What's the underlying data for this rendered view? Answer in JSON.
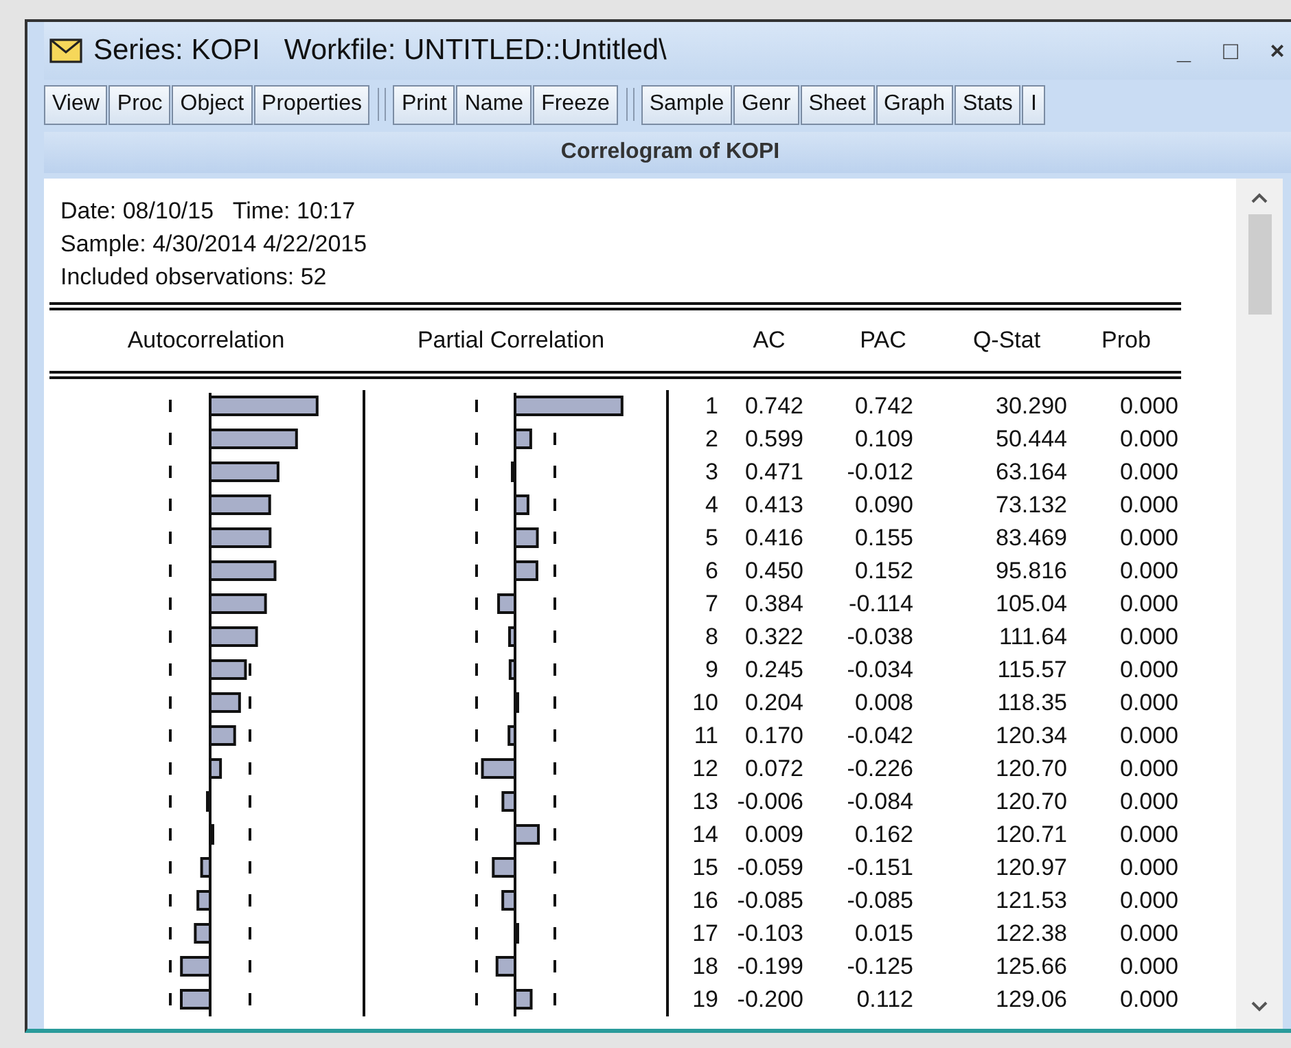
{
  "window": {
    "title": "Series: KOPI   Workfile: UNTITLED::Untitled\\",
    "controls": [
      "_",
      "□",
      "×"
    ]
  },
  "toolbar": [
    [
      "View",
      "Proc",
      "Object",
      "Properties"
    ],
    [
      "Print",
      "Name",
      "Freeze"
    ],
    [
      "Sample",
      "Genr",
      "Sheet",
      "Graph",
      "Stats",
      "I"
    ]
  ],
  "view_title": "Correlogram of KOPI",
  "info": [
    "Date: 08/10/15   Time: 10:17",
    "Sample: 4/30/2014 4/22/2015",
    "Included observations: 52"
  ],
  "columns": [
    "Autocorrelation",
    "Partial Correlation",
    "AC",
    "PAC",
    "Q-Stat",
    "Prob"
  ],
  "rows": [
    {
      "lag": "1",
      "ac": "0.742",
      "pac": "0.742",
      "q": "30.290",
      "prob": "0.000"
    },
    {
      "lag": "2",
      "ac": "0.599",
      "pac": "0.109",
      "q": "50.444",
      "prob": "0.000"
    },
    {
      "lag": "3",
      "ac": "0.471",
      "pac": "-0.012",
      "q": "63.164",
      "prob": "0.000"
    },
    {
      "lag": "4",
      "ac": "0.413",
      "pac": "0.090",
      "q": "73.132",
      "prob": "0.000"
    },
    {
      "lag": "5",
      "ac": "0.416",
      "pac": "0.155",
      "q": "83.469",
      "prob": "0.000"
    },
    {
      "lag": "6",
      "ac": "0.450",
      "pac": "0.152",
      "q": "95.816",
      "prob": "0.000"
    },
    {
      "lag": "7",
      "ac": "0.384",
      "pac": "-0.114",
      "q": "105.04",
      "prob": "0.000"
    },
    {
      "lag": "8",
      "ac": "0.322",
      "pac": "-0.038",
      "q": "111.64",
      "prob": "0.000"
    },
    {
      "lag": "9",
      "ac": "0.245",
      "pac": "-0.034",
      "q": "115.57",
      "prob": "0.000"
    },
    {
      "lag": "10",
      "ac": "0.204",
      "pac": "0.008",
      "q": "118.35",
      "prob": "0.000"
    },
    {
      "lag": "11",
      "ac": "0.170",
      "pac": "-0.042",
      "q": "120.34",
      "prob": "0.000"
    },
    {
      "lag": "12",
      "ac": "0.072",
      "pac": "-0.226",
      "q": "120.70",
      "prob": "0.000"
    },
    {
      "lag": "13",
      "ac": "-0.006",
      "pac": "-0.084",
      "q": "120.70",
      "prob": "0.000"
    },
    {
      "lag": "14",
      "ac": "0.009",
      "pac": "0.162",
      "q": "120.71",
      "prob": "0.000"
    },
    {
      "lag": "15",
      "ac": "-0.059",
      "pac": "-0.151",
      "q": "120.97",
      "prob": "0.000"
    },
    {
      "lag": "16",
      "ac": "-0.085",
      "pac": "-0.085",
      "q": "121.53",
      "prob": "0.000"
    },
    {
      "lag": "17",
      "ac": "-0.103",
      "pac": "0.015",
      "q": "122.38",
      "prob": "0.000"
    },
    {
      "lag": "18",
      "ac": "-0.199",
      "pac": "-0.125",
      "q": "125.66",
      "prob": "0.000"
    },
    {
      "lag": "19",
      "ac": "-0.200",
      "pac": "0.112",
      "q": "129.06",
      "prob": "0.000"
    }
  ]
}
